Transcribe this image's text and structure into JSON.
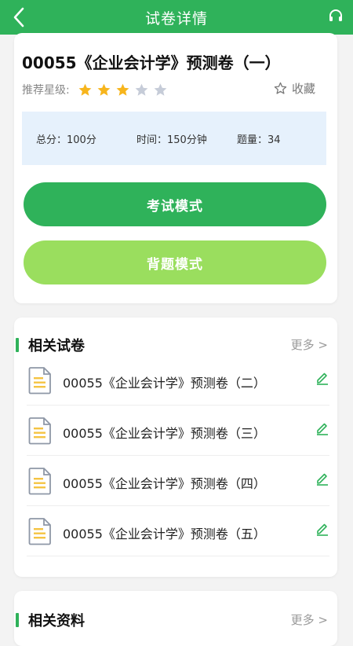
{
  "colors": {
    "primary_green": "#2fb25a",
    "light_green": "#9ade5e",
    "star_active": "#f7b51c",
    "star_inactive": "#c6ccd8",
    "stats_bg": "#e6f1fc"
  },
  "header": {
    "title": "试卷详情",
    "back_icon": "chevron-left-icon",
    "right_icon": "headset-icon"
  },
  "paper": {
    "title": "00055《企业会计学》预测卷（一）",
    "rating_label": "推荐星级:",
    "rating": 3,
    "rating_max": 5,
    "favorite_label": "收藏",
    "stats": {
      "total": "总分：100分",
      "time": "时间：150分钟",
      "count": "题量：34"
    },
    "exam_mode_label": "考试模式",
    "recite_mode_label": "背题模式"
  },
  "related_papers": {
    "heading": "相关试卷",
    "more_label": "更多 >",
    "items": [
      {
        "title": "00055《企业会计学》预测卷（二）"
      },
      {
        "title": "00055《企业会计学》预测卷（三）"
      },
      {
        "title": "00055《企业会计学》预测卷（四）"
      },
      {
        "title": "00055《企业会计学》预测卷（五）"
      }
    ]
  },
  "related_materials": {
    "heading": "相关资料",
    "more_label": "更多 >"
  }
}
